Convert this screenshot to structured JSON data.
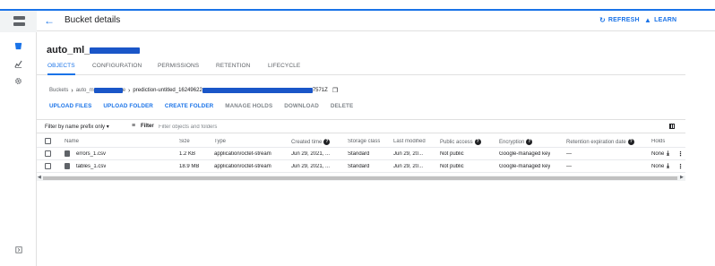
{
  "header": {
    "title": "Bucket details",
    "refresh_label": "REFRESH",
    "learn_label": "LEARN"
  },
  "bucket": {
    "name_prefix": "auto_ml_"
  },
  "tabs": [
    {
      "label": "OBJECTS",
      "active": true
    },
    {
      "label": "CONFIGURATION",
      "active": false
    },
    {
      "label": "PERMISSIONS",
      "active": false
    },
    {
      "label": "RETENTION",
      "active": false
    },
    {
      "label": "LIFECYCLE",
      "active": false
    }
  ],
  "breadcrumb": {
    "root": "Buckets",
    "bucket_prefix": "auto_m",
    "bucket_suffix": "e",
    "folder_prefix": "prediction-untitled_16249622",
    "folder_suffix": "7571Z"
  },
  "actions": {
    "upload_files": "UPLOAD FILES",
    "upload_folder": "UPLOAD FOLDER",
    "create_folder": "CREATE FOLDER",
    "manage_holds": "MANAGE HOLDS",
    "download": "DOWNLOAD",
    "delete": "DELETE"
  },
  "filter": {
    "prefix_label": "Filter by name prefix only",
    "label": "Filter",
    "placeholder": "Filter objects and folders"
  },
  "table": {
    "columns": {
      "name": "Name",
      "size": "Size",
      "type": "Type",
      "created": "Created time",
      "storage": "Storage class",
      "modified": "Last modified",
      "access": "Public access",
      "encryption": "Encryption",
      "retention": "Retention expiration date",
      "holds": "Holds"
    },
    "rows": [
      {
        "name": "errors_1.csv",
        "size": "1.2 KB",
        "type": "application/octet-stream",
        "created": "Jun 29, 2021, ...",
        "storage": "Standard",
        "modified": "Jun 29, 20...",
        "access": "Not public",
        "encryption": "Google-managed key",
        "retention": "—",
        "holds": "None"
      },
      {
        "name": "tables_1.csv",
        "size": "18.9 MB",
        "type": "application/octet-stream",
        "created": "Jun 29, 2021, ...",
        "storage": "Standard",
        "modified": "Jun 29, 20...",
        "access": "Not public",
        "encryption": "Google-managed key",
        "retention": "—",
        "holds": "None"
      }
    ]
  },
  "colors": {
    "accent": "#1a73e8",
    "redaction": "#1a56c8"
  },
  "icons": {
    "back": "arrow-left-icon",
    "refresh": "refresh-icon",
    "learn": "school-icon",
    "copy": "copy-icon",
    "filter": "filter-icon",
    "columns": "column-display-icon",
    "download": "download-icon",
    "more": "more-vert-icon"
  }
}
